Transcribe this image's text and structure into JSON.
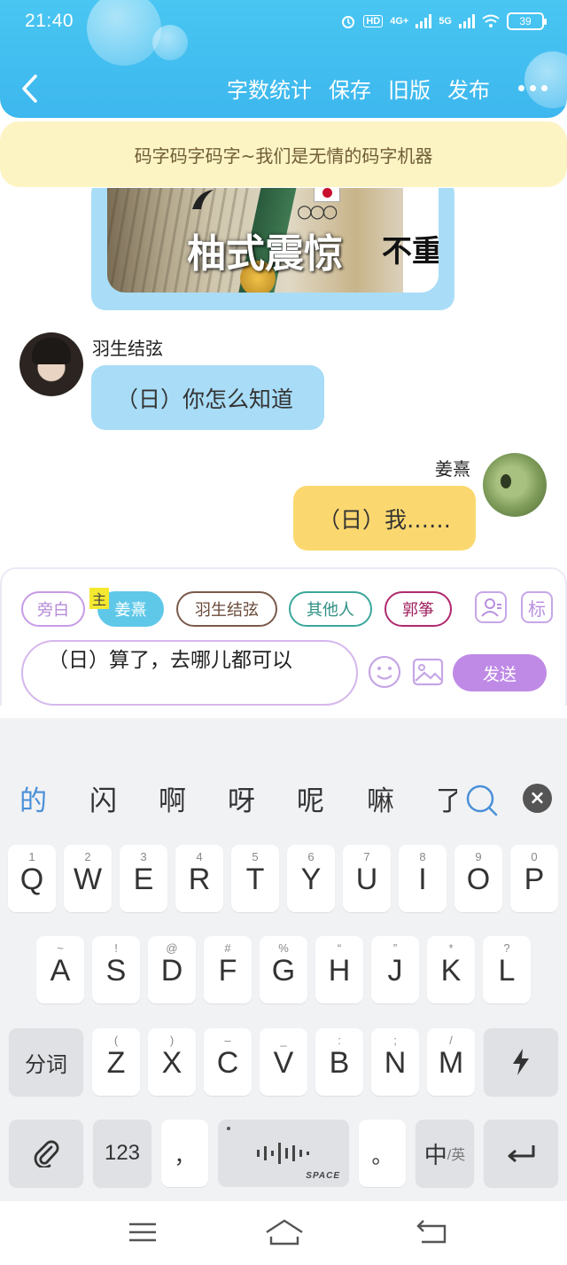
{
  "status_bar": {
    "time": "21:40",
    "network1": "4G+",
    "network2": "5G",
    "hd": "HD",
    "battery": "39"
  },
  "header": {
    "actions": [
      "字数统计",
      "保存",
      "旧版",
      "发布"
    ],
    "brand_color": "#3db7ee"
  },
  "notice": "码字码字码字~我们是无情的码字机器",
  "chat": {
    "image_caption": "柚式震惊",
    "image_side_text": "不重",
    "messages": [
      {
        "sender": "羽生结弦",
        "text": "（日）你怎么知道",
        "side": "left",
        "color": "#a8dcf7"
      },
      {
        "sender": "姜熹",
        "text": "（日）我……",
        "side": "right",
        "color": "#fbd86f"
      }
    ]
  },
  "input_panel": {
    "roles": [
      "旁白",
      "姜熹",
      "羽生结弦",
      "其他人",
      "郭筝"
    ],
    "main_tag": "主",
    "tag_button": "标",
    "input_value": "（日）算了，去哪儿都可以",
    "send_label": "发送"
  },
  "keyboard": {
    "candidates": [
      "的",
      "闪",
      "啊",
      "呀",
      "呢",
      "嘛",
      "了"
    ],
    "row1": [
      {
        "k": "Q",
        "s": "1"
      },
      {
        "k": "W",
        "s": "2"
      },
      {
        "k": "E",
        "s": "3"
      },
      {
        "k": "R",
        "s": "4"
      },
      {
        "k": "T",
        "s": "5"
      },
      {
        "k": "Y",
        "s": "6"
      },
      {
        "k": "U",
        "s": "7"
      },
      {
        "k": "I",
        "s": "8"
      },
      {
        "k": "O",
        "s": "9"
      },
      {
        "k": "P",
        "s": "0"
      }
    ],
    "row2": [
      {
        "k": "A",
        "s": "~"
      },
      {
        "k": "S",
        "s": "!"
      },
      {
        "k": "D",
        "s": "@"
      },
      {
        "k": "F",
        "s": "#"
      },
      {
        "k": "G",
        "s": "%"
      },
      {
        "k": "H",
        "s": "“"
      },
      {
        "k": "J",
        "s": "”"
      },
      {
        "k": "K",
        "s": "*"
      },
      {
        "k": "L",
        "s": "?"
      }
    ],
    "row3": [
      {
        "k": "Z",
        "s": "("
      },
      {
        "k": "X",
        "s": ")"
      },
      {
        "k": "C",
        "s": "–"
      },
      {
        "k": "V",
        "s": "_"
      },
      {
        "k": "B",
        "s": ":"
      },
      {
        "k": "N",
        "s": ";"
      },
      {
        "k": "M",
        "s": "/"
      }
    ],
    "segment_key": "分词",
    "num_key": "123",
    "comma_key": "，",
    "period_key": "。",
    "lang_key_main": "中",
    "lang_key_sub": "/英",
    "space_label": "SPACE"
  }
}
